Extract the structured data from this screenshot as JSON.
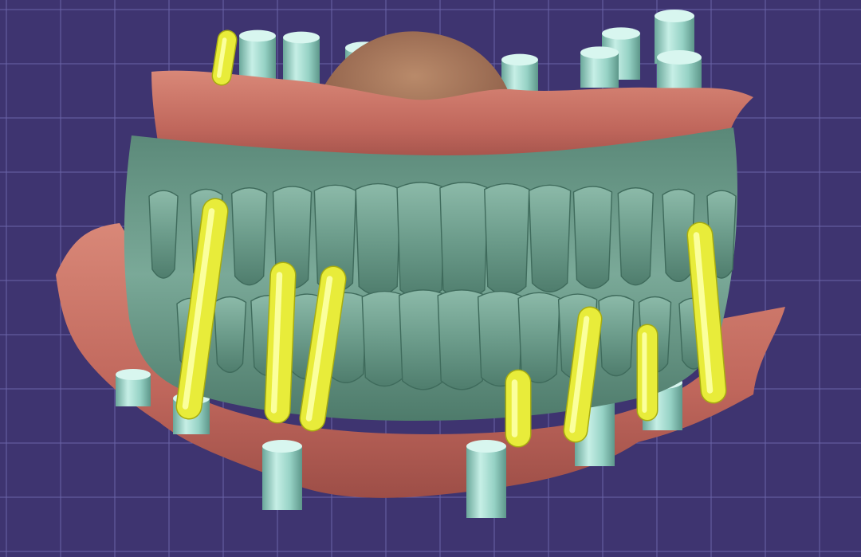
{
  "viewport": {
    "background_color": "#3e3470",
    "grid_color": "#6a64a8",
    "grid_visible": true
  },
  "model": {
    "tooth_color": "#6f9e8d",
    "gingiva_color": "#c46d62",
    "abutment_color": "#9ed8cc",
    "implant_color": "#e8ec3a",
    "upper_teeth_count": 14,
    "lower_teeth_count": 14,
    "implant_count": 8,
    "abutment_count": 16
  }
}
